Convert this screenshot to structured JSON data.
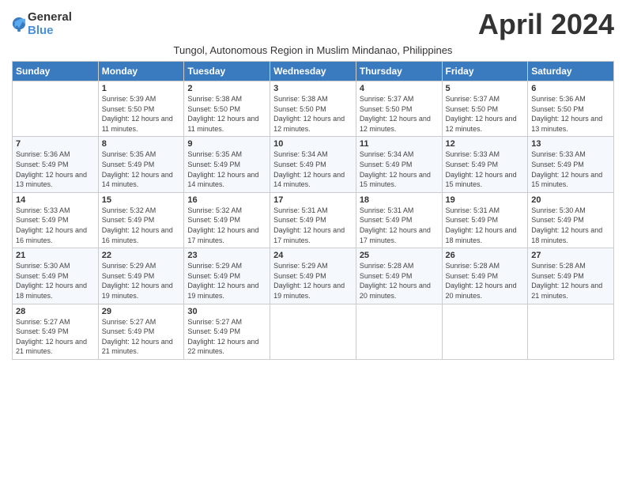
{
  "header": {
    "logo_general": "General",
    "logo_blue": "Blue",
    "month_title": "April 2024",
    "subtitle": "Tungol, Autonomous Region in Muslim Mindanao, Philippines"
  },
  "columns": [
    "Sunday",
    "Monday",
    "Tuesday",
    "Wednesday",
    "Thursday",
    "Friday",
    "Saturday"
  ],
  "weeks": [
    [
      {
        "day": "",
        "sunrise": "",
        "sunset": "",
        "daylight": ""
      },
      {
        "day": "1",
        "sunrise": "Sunrise: 5:39 AM",
        "sunset": "Sunset: 5:50 PM",
        "daylight": "Daylight: 12 hours and 11 minutes."
      },
      {
        "day": "2",
        "sunrise": "Sunrise: 5:38 AM",
        "sunset": "Sunset: 5:50 PM",
        "daylight": "Daylight: 12 hours and 11 minutes."
      },
      {
        "day": "3",
        "sunrise": "Sunrise: 5:38 AM",
        "sunset": "Sunset: 5:50 PM",
        "daylight": "Daylight: 12 hours and 12 minutes."
      },
      {
        "day": "4",
        "sunrise": "Sunrise: 5:37 AM",
        "sunset": "Sunset: 5:50 PM",
        "daylight": "Daylight: 12 hours and 12 minutes."
      },
      {
        "day": "5",
        "sunrise": "Sunrise: 5:37 AM",
        "sunset": "Sunset: 5:50 PM",
        "daylight": "Daylight: 12 hours and 12 minutes."
      },
      {
        "day": "6",
        "sunrise": "Sunrise: 5:36 AM",
        "sunset": "Sunset: 5:50 PM",
        "daylight": "Daylight: 12 hours and 13 minutes."
      }
    ],
    [
      {
        "day": "7",
        "sunrise": "Sunrise: 5:36 AM",
        "sunset": "Sunset: 5:49 PM",
        "daylight": "Daylight: 12 hours and 13 minutes."
      },
      {
        "day": "8",
        "sunrise": "Sunrise: 5:35 AM",
        "sunset": "Sunset: 5:49 PM",
        "daylight": "Daylight: 12 hours and 14 minutes."
      },
      {
        "day": "9",
        "sunrise": "Sunrise: 5:35 AM",
        "sunset": "Sunset: 5:49 PM",
        "daylight": "Daylight: 12 hours and 14 minutes."
      },
      {
        "day": "10",
        "sunrise": "Sunrise: 5:34 AM",
        "sunset": "Sunset: 5:49 PM",
        "daylight": "Daylight: 12 hours and 14 minutes."
      },
      {
        "day": "11",
        "sunrise": "Sunrise: 5:34 AM",
        "sunset": "Sunset: 5:49 PM",
        "daylight": "Daylight: 12 hours and 15 minutes."
      },
      {
        "day": "12",
        "sunrise": "Sunrise: 5:33 AM",
        "sunset": "Sunset: 5:49 PM",
        "daylight": "Daylight: 12 hours and 15 minutes."
      },
      {
        "day": "13",
        "sunrise": "Sunrise: 5:33 AM",
        "sunset": "Sunset: 5:49 PM",
        "daylight": "Daylight: 12 hours and 15 minutes."
      }
    ],
    [
      {
        "day": "14",
        "sunrise": "Sunrise: 5:33 AM",
        "sunset": "Sunset: 5:49 PM",
        "daylight": "Daylight: 12 hours and 16 minutes."
      },
      {
        "day": "15",
        "sunrise": "Sunrise: 5:32 AM",
        "sunset": "Sunset: 5:49 PM",
        "daylight": "Daylight: 12 hours and 16 minutes."
      },
      {
        "day": "16",
        "sunrise": "Sunrise: 5:32 AM",
        "sunset": "Sunset: 5:49 PM",
        "daylight": "Daylight: 12 hours and 17 minutes."
      },
      {
        "day": "17",
        "sunrise": "Sunrise: 5:31 AM",
        "sunset": "Sunset: 5:49 PM",
        "daylight": "Daylight: 12 hours and 17 minutes."
      },
      {
        "day": "18",
        "sunrise": "Sunrise: 5:31 AM",
        "sunset": "Sunset: 5:49 PM",
        "daylight": "Daylight: 12 hours and 17 minutes."
      },
      {
        "day": "19",
        "sunrise": "Sunrise: 5:31 AM",
        "sunset": "Sunset: 5:49 PM",
        "daylight": "Daylight: 12 hours and 18 minutes."
      },
      {
        "day": "20",
        "sunrise": "Sunrise: 5:30 AM",
        "sunset": "Sunset: 5:49 PM",
        "daylight": "Daylight: 12 hours and 18 minutes."
      }
    ],
    [
      {
        "day": "21",
        "sunrise": "Sunrise: 5:30 AM",
        "sunset": "Sunset: 5:49 PM",
        "daylight": "Daylight: 12 hours and 18 minutes."
      },
      {
        "day": "22",
        "sunrise": "Sunrise: 5:29 AM",
        "sunset": "Sunset: 5:49 PM",
        "daylight": "Daylight: 12 hours and 19 minutes."
      },
      {
        "day": "23",
        "sunrise": "Sunrise: 5:29 AM",
        "sunset": "Sunset: 5:49 PM",
        "daylight": "Daylight: 12 hours and 19 minutes."
      },
      {
        "day": "24",
        "sunrise": "Sunrise: 5:29 AM",
        "sunset": "Sunset: 5:49 PM",
        "daylight": "Daylight: 12 hours and 19 minutes."
      },
      {
        "day": "25",
        "sunrise": "Sunrise: 5:28 AM",
        "sunset": "Sunset: 5:49 PM",
        "daylight": "Daylight: 12 hours and 20 minutes."
      },
      {
        "day": "26",
        "sunrise": "Sunrise: 5:28 AM",
        "sunset": "Sunset: 5:49 PM",
        "daylight": "Daylight: 12 hours and 20 minutes."
      },
      {
        "day": "27",
        "sunrise": "Sunrise: 5:28 AM",
        "sunset": "Sunset: 5:49 PM",
        "daylight": "Daylight: 12 hours and 21 minutes."
      }
    ],
    [
      {
        "day": "28",
        "sunrise": "Sunrise: 5:27 AM",
        "sunset": "Sunset: 5:49 PM",
        "daylight": "Daylight: 12 hours and 21 minutes."
      },
      {
        "day": "29",
        "sunrise": "Sunrise: 5:27 AM",
        "sunset": "Sunset: 5:49 PM",
        "daylight": "Daylight: 12 hours and 21 minutes."
      },
      {
        "day": "30",
        "sunrise": "Sunrise: 5:27 AM",
        "sunset": "Sunset: 5:49 PM",
        "daylight": "Daylight: 12 hours and 22 minutes."
      },
      {
        "day": "",
        "sunrise": "",
        "sunset": "",
        "daylight": ""
      },
      {
        "day": "",
        "sunrise": "",
        "sunset": "",
        "daylight": ""
      },
      {
        "day": "",
        "sunrise": "",
        "sunset": "",
        "daylight": ""
      },
      {
        "day": "",
        "sunrise": "",
        "sunset": "",
        "daylight": ""
      }
    ]
  ]
}
